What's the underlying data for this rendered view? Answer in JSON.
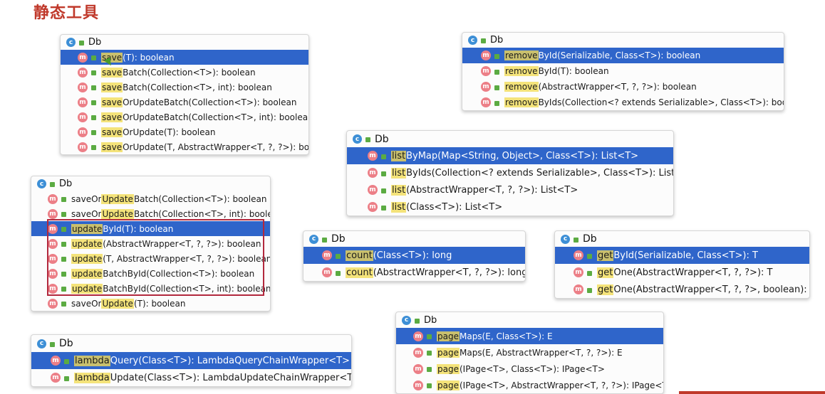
{
  "page_title": "静态工具",
  "class_name": "Db",
  "popups": [
    {
      "id": "save",
      "rows": [
        {
          "hl": "save",
          "rest": "(T): boolean",
          "sel": true
        },
        {
          "hl": "save",
          "rest": "Batch(Collection<T>): boolean"
        },
        {
          "hl": "save",
          "rest": "Batch(Collection<T>, int): boolean"
        },
        {
          "hl": "save",
          "rest": "OrUpdateBatch(Collection<T>): boolean"
        },
        {
          "hl": "save",
          "rest": "OrUpdateBatch(Collection<T>, int): boolean"
        },
        {
          "hl": "save",
          "rest": "OrUpdate(T): boolean"
        },
        {
          "hl": "save",
          "rest": "OrUpdate(T, AbstractWrapper<T, ?, ?>): boolean"
        }
      ]
    },
    {
      "id": "remove",
      "rows": [
        {
          "hl": "remove",
          "rest": "ById(Serializable, Class<T>): boolean",
          "sel": true
        },
        {
          "hl": "remove",
          "rest": "ById(T): boolean"
        },
        {
          "hl": "remove",
          "rest": "(AbstractWrapper<T, ?, ?>): boolean"
        },
        {
          "hl": "remove",
          "rest": "ByIds(Collection<? extends Serializable>, Class<T>): boolean"
        }
      ]
    },
    {
      "id": "list",
      "rows": [
        {
          "hl": "list",
          "rest": "ByMap(Map<String, Object>, Class<T>): List<T>",
          "sel": true
        },
        {
          "hl": "list",
          "rest": "ByIds(Collection<? extends Serializable>, Class<T>): List<T>"
        },
        {
          "hl": "list",
          "rest": "(AbstractWrapper<T, ?, ?>): List<T>"
        },
        {
          "hl": "list",
          "rest": "(Class<T>): List<T>"
        }
      ]
    },
    {
      "id": "update",
      "rows": [
        {
          "pre": "saveOr",
          "hl": "Update",
          "rest": "Batch(Collection<T>): boolean"
        },
        {
          "pre": "saveOr",
          "hl": "Update",
          "rest": "Batch(Collection<T>, int): boolean"
        },
        {
          "hl": "update",
          "rest": "ById(T): boolean",
          "sel": true
        },
        {
          "hl": "update",
          "rest": "(AbstractWrapper<T, ?, ?>): boolean"
        },
        {
          "hl": "update",
          "rest": "(T, AbstractWrapper<T, ?, ?>): boolean"
        },
        {
          "hl": "update",
          "rest": "BatchById(Collection<T>): boolean"
        },
        {
          "hl": "update",
          "rest": "BatchById(Collection<T>, int): boolean"
        },
        {
          "pre": "saveOr",
          "hl": "Update",
          "rest": "(T): boolean"
        }
      ]
    },
    {
      "id": "count",
      "rows": [
        {
          "hl": "count",
          "rest": "(Class<T>): long",
          "sel": true
        },
        {
          "hl": "count",
          "rest": "(AbstractWrapper<T, ?, ?>): long"
        }
      ]
    },
    {
      "id": "get",
      "rows": [
        {
          "hl": "get",
          "rest": "ById(Serializable, Class<T>): T",
          "sel": true
        },
        {
          "hl": "get",
          "rest": "One(AbstractWrapper<T, ?, ?>): T"
        },
        {
          "hl": "get",
          "rest": "One(AbstractWrapper<T, ?, ?>, boolean): T"
        }
      ]
    },
    {
      "id": "lambda",
      "rows": [
        {
          "hl": "lambda",
          "rest": "Query(Class<T>): LambdaQueryChainWrapper<T>",
          "sel": true
        },
        {
          "hl": "lambda",
          "rest": "Update(Class<T>): LambdaUpdateChainWrapper<T>"
        }
      ]
    },
    {
      "id": "page",
      "rows": [
        {
          "hl": "page",
          "rest": "Maps(E, Class<T>): E",
          "sel": true
        },
        {
          "hl": "page",
          "rest": "Maps(E, AbstractWrapper<T, ?, ?>): E"
        },
        {
          "hl": "page",
          "rest": "(IPage<T>, Class<T>): IPage<T>"
        },
        {
          "hl": "page",
          "rest": "(IPage<T>, AbstractWrapper<T, ?, ?>): IPage<T>"
        }
      ]
    }
  ],
  "icons": {
    "class_glyph": "c",
    "method_glyph": "m"
  },
  "colors": {
    "title": "#c0392b",
    "selection": "#2f65ca",
    "match_highlight": "#f4e37a",
    "method_icon": "#ec7f87",
    "class_icon": "#3d8fd6",
    "annotation_box": "#b2283d"
  }
}
